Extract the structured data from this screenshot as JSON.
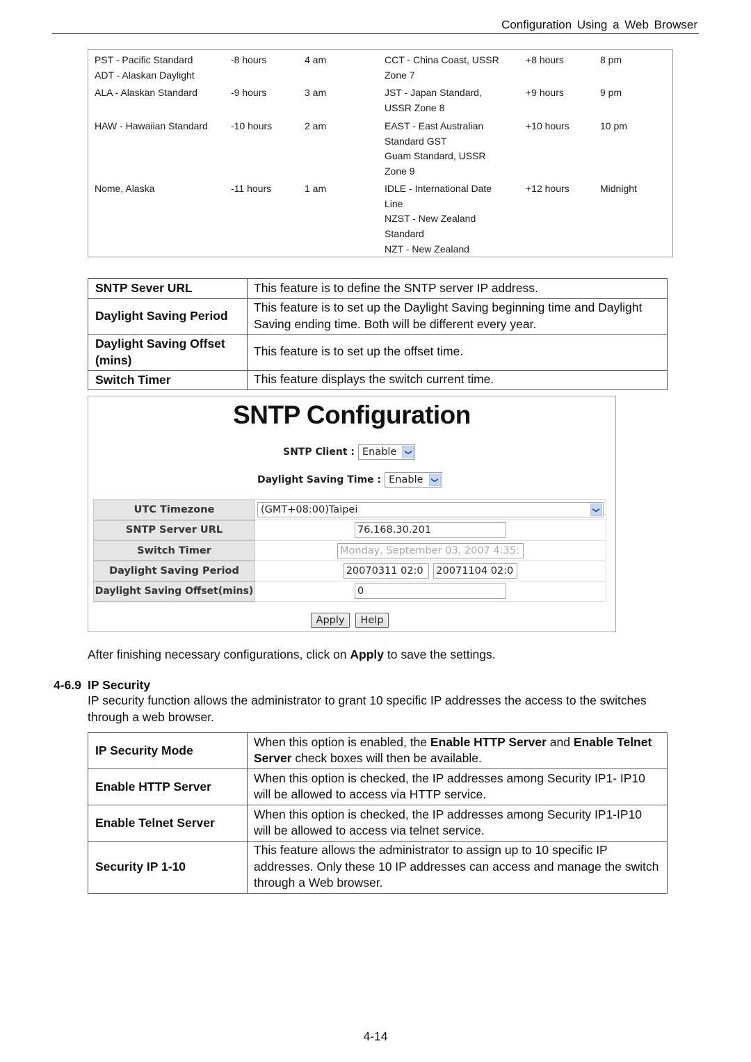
{
  "header": {
    "title": "Configuration Using a Web Browser"
  },
  "timezone_table": {
    "rows": [
      {
        "zone_west": [
          "PST - Pacific Standard",
          "ADT - Alaskan Daylight"
        ],
        "offset_west": "-8 hours",
        "time_west": "4 am",
        "zone_east": [
          "CCT - China Coast, USSR",
          "Zone 7"
        ],
        "offset_east": "+8 hours",
        "time_east": "8 pm"
      },
      {
        "zone_west": [
          "ALA - Alaskan Standard"
        ],
        "offset_west": "-9 hours",
        "time_west": "3 am",
        "zone_east": [
          "JST - Japan Standard,",
          "USSR Zone 8"
        ],
        "offset_east": "+9 hours",
        "time_east": "9 pm"
      },
      {
        "zone_west": [
          "HAW - Hawaiian Standard"
        ],
        "offset_west": "-10 hours",
        "time_west": "2 am",
        "zone_east": [
          "EAST - East Australian",
          "Standard GST",
          "Guam Standard, USSR",
          "Zone 9"
        ],
        "offset_east": "+10 hours",
        "time_east": "10 pm"
      },
      {
        "zone_west": [
          "Nome, Alaska"
        ],
        "offset_west": "-11 hours",
        "time_west": "1 am",
        "zone_east": [
          "IDLE - International Date",
          "Line",
          "NZST - New Zealand",
          "Standard",
          "NZT - New Zealand"
        ],
        "offset_east": "+12 hours",
        "time_east": "Midnight"
      }
    ]
  },
  "sntp_features": [
    {
      "name": "SNTP Sever URL",
      "description": "This feature is to define the SNTP server IP address."
    },
    {
      "name": "Daylight Saving Period",
      "description": "This feature is to set up the Daylight Saving beginning time and Daylight Saving ending time. Both will be different every year."
    },
    {
      "name": "Daylight Saving Offset (mins)",
      "description": "This feature is to set up the offset time."
    },
    {
      "name": "Switch Timer",
      "description": "This feature displays the switch current time."
    }
  ],
  "sntp_config": {
    "title": "SNTP Configuration",
    "sntp_client": {
      "label": "SNTP Client :",
      "value": "Enable"
    },
    "daylight_saving_time": {
      "label": "Daylight Saving Time :",
      "value": "Enable"
    },
    "utc_timezone": {
      "label": "UTC Timezone",
      "value": "(GMT+08:00)Taipei"
    },
    "sntp_server_url": {
      "label": "SNTP Server URL",
      "value": "76.168.30.201"
    },
    "switch_timer": {
      "label": "Switch Timer",
      "value": "Monday, September 03, 2007 4:35:"
    },
    "daylight_saving_period": {
      "label": "Daylight Saving Period",
      "start": "20070311 02:0",
      "end": "20071104 02:0"
    },
    "daylight_saving_offset": {
      "label": "Daylight Saving Offset(mins)",
      "value": "0"
    },
    "apply_label": "Apply",
    "help_label": "Help",
    "dropdown_icon": "chevron-down-icon"
  },
  "after_text": {
    "before": "After finishing necessary configurations, click on ",
    "bold": "Apply",
    "after": " to save the settings."
  },
  "section": {
    "number": "4-6.9",
    "title": "IP Security",
    "intro": "IP security function allows the administrator to grant 10 specific IP addresses the access to the switches through a web browser."
  },
  "ip_security_features": [
    {
      "name": "IP Security Mode",
      "parts": [
        "When this option is enabled, the ",
        "Enable HTTP Server",
        " and ",
        "Enable Telnet Server",
        " check boxes will then be available."
      ]
    },
    {
      "name": "Enable HTTP Server",
      "description": "When this option is checked, the IP addresses among Security IP1- IP10 will be allowed to access via HTTP service."
    },
    {
      "name": "Enable Telnet Server",
      "description": "When this option is checked, the IP addresses among Security IP1-IP10 will be allowed to access via telnet service."
    },
    {
      "name": "Security IP 1-10",
      "description": "This feature allows the administrator to assign up to 10 specific IP addresses. Only these 10 IP addresses can access and manage the switch through a Web browser."
    }
  ],
  "page_number": "4-14"
}
